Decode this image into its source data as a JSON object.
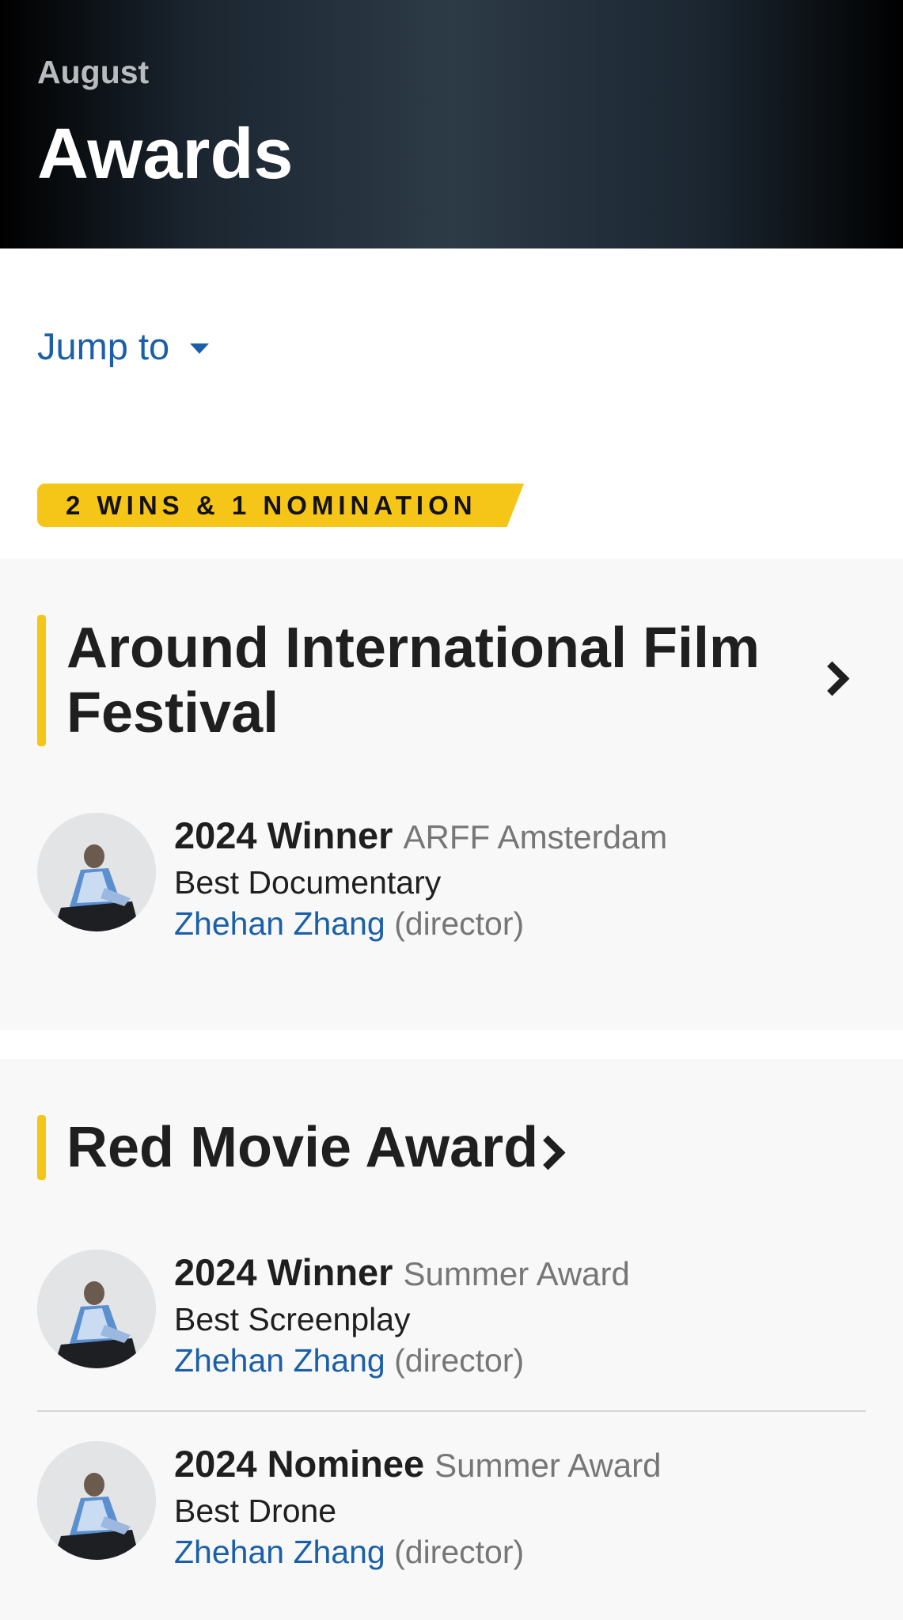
{
  "header": {
    "subtitle": "August",
    "title": "Awards"
  },
  "jump_to": {
    "label": "Jump to"
  },
  "summary_badge": "2 WINS & 1 NOMINATION",
  "colors": {
    "accent": "#f5c518",
    "link": "#1b5fa8"
  },
  "sections": [
    {
      "title_line1": "Around International Film",
      "title_line2": "Festival",
      "awards": [
        {
          "outcome": "2024 Winner",
          "event": "ARFF Amsterdam",
          "category": "Best Documentary",
          "person": "Zhehan Zhang",
          "role": "(director)"
        }
      ]
    },
    {
      "title": "Red Movie Award",
      "awards": [
        {
          "outcome": "2024 Winner",
          "event": "Summer Award",
          "category": "Best Screenplay",
          "person": "Zhehan Zhang",
          "role": "(director)"
        },
        {
          "outcome": "2024 Nominee",
          "event": "Summer Award",
          "category": "Best Drone",
          "person": "Zhehan Zhang",
          "role": "(director)"
        }
      ]
    }
  ]
}
